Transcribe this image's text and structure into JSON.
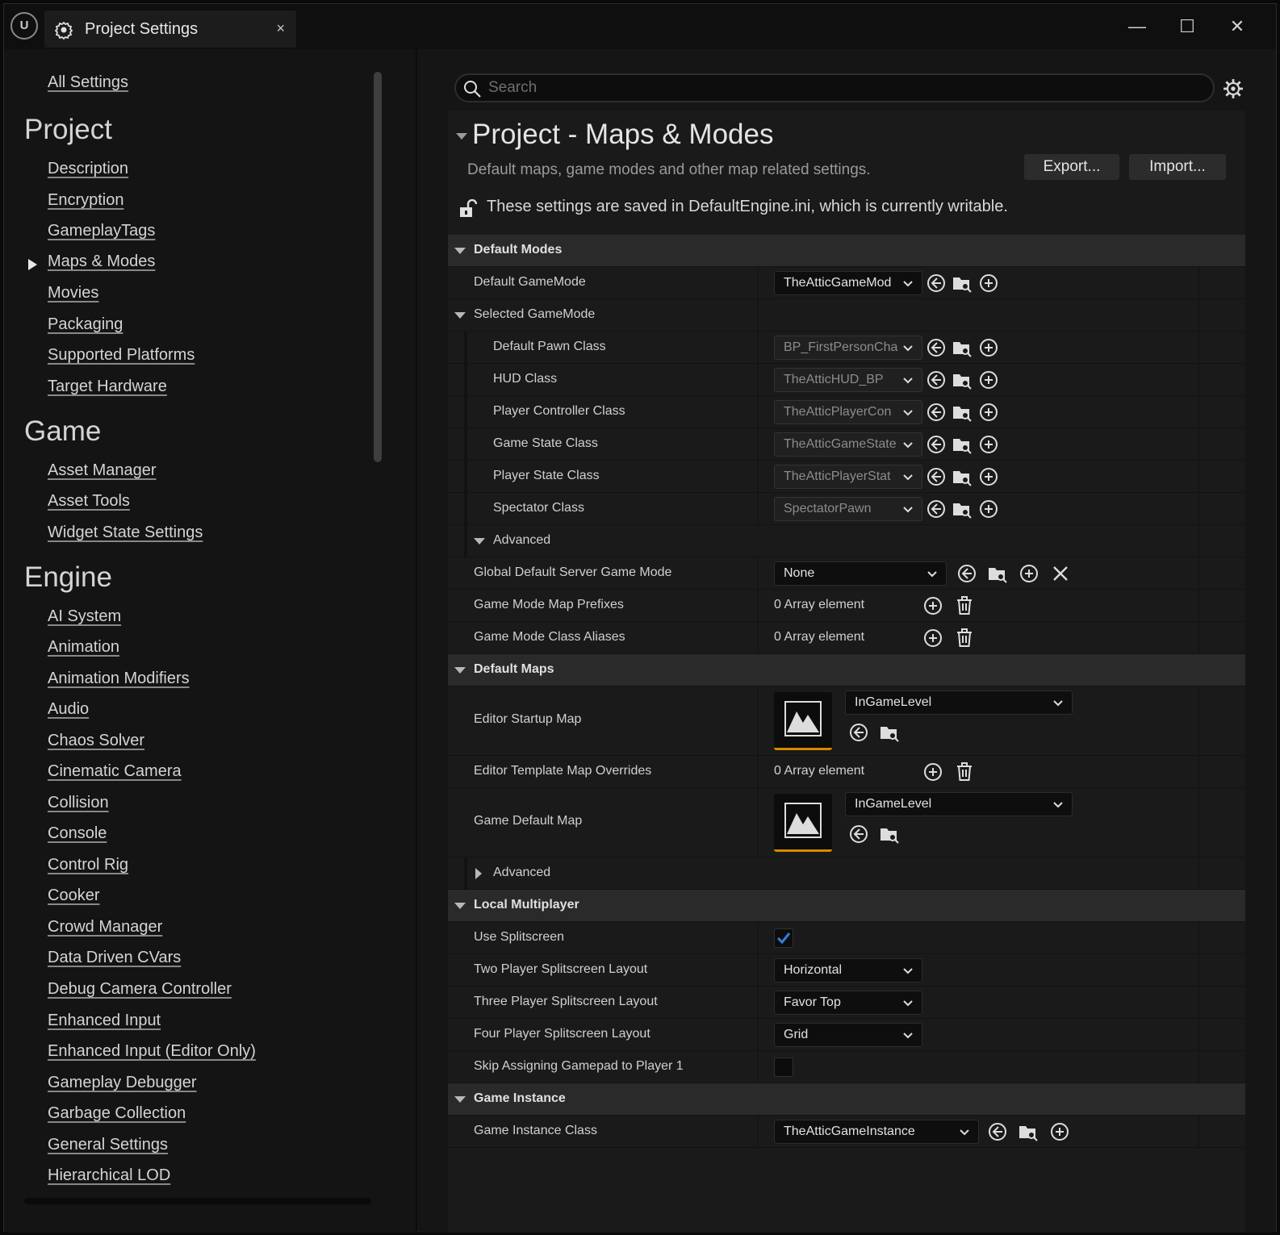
{
  "window": {
    "tab_title": "Project Settings",
    "tab_close": "×",
    "logo": "U",
    "minimize": "—",
    "maximize": "☐",
    "close": "✕"
  },
  "sidebar": {
    "all_settings": "All Settings",
    "sections": [
      {
        "title": "Project",
        "items": [
          "Description",
          "Encryption",
          "GameplayTags",
          "Maps & Modes",
          "Movies",
          "Packaging",
          "Supported Platforms",
          "Target Hardware"
        ]
      },
      {
        "title": "Game",
        "items": [
          "Asset Manager",
          "Asset Tools",
          "Widget State Settings"
        ]
      },
      {
        "title": "Engine",
        "items": [
          "AI System",
          "Animation",
          "Animation Modifiers",
          "Audio",
          "Chaos Solver",
          "Cinematic Camera",
          "Collision",
          "Console",
          "Control Rig",
          "Cooker",
          "Crowd Manager",
          "Data Driven CVars",
          "Debug Camera Controller",
          "Enhanced Input",
          "Enhanced Input (Editor Only)",
          "Gameplay Debugger",
          "Garbage Collection",
          "General Settings",
          "Hierarchical LOD"
        ]
      }
    ],
    "selected": "Maps & Modes"
  },
  "search": {
    "placeholder": "Search"
  },
  "page": {
    "title": "Project - Maps & Modes",
    "description": "Default maps, game modes and other map related settings.",
    "export_label": "Export...",
    "import_label": "Import...",
    "note": "These settings are saved in DefaultEngine.ini, which is currently writable."
  },
  "default_modes": {
    "header": "Default Modes",
    "default_gamemode": {
      "label": "Default GameMode",
      "value": "TheAtticGameMod"
    },
    "selected_gamemode": "Selected GameMode",
    "pawn": {
      "label": "Default Pawn Class",
      "value": "BP_FirstPersonCha"
    },
    "hud": {
      "label": "HUD Class",
      "value": "TheAtticHUD_BP"
    },
    "controller": {
      "label": "Player Controller Class",
      "value": "TheAtticPlayerCon"
    },
    "game_state": {
      "label": "Game State Class",
      "value": "TheAtticGameState"
    },
    "player_state": {
      "label": "Player State Class",
      "value": "TheAtticPlayerStat"
    },
    "spectator": {
      "label": "Spectator Class",
      "value": "SpectatorPawn"
    },
    "advanced": "Advanced",
    "server_mode": {
      "label": "Global Default Server Game Mode",
      "value": "None"
    },
    "prefixes": {
      "label": "Game Mode Map Prefixes",
      "value": "0 Array element"
    },
    "aliases": {
      "label": "Game Mode Class Aliases",
      "value": "0 Array element"
    }
  },
  "default_maps": {
    "header": "Default Maps",
    "startup": {
      "label": "Editor Startup Map",
      "value": "InGameLevel"
    },
    "template": {
      "label": "Editor Template Map Overrides",
      "value": "0 Array element"
    },
    "game_default": {
      "label": "Game Default Map",
      "value": "InGameLevel"
    },
    "advanced": "Advanced"
  },
  "local_multiplayer": {
    "header": "Local Multiplayer",
    "use_splitscreen": {
      "label": "Use Splitscreen",
      "checked": true
    },
    "two_player": {
      "label": "Two Player Splitscreen Layout",
      "value": "Horizontal"
    },
    "three_player": {
      "label": "Three Player Splitscreen Layout",
      "value": "Favor Top"
    },
    "four_player": {
      "label": "Four Player Splitscreen Layout",
      "value": "Grid"
    },
    "skip_gamepad": {
      "label": "Skip Assigning Gamepad to Player 1",
      "checked": false
    }
  },
  "game_instance": {
    "header": "Game Instance",
    "class": {
      "label": "Game Instance Class",
      "value": "TheAtticGameInstance"
    }
  },
  "colors": {
    "accent": "#2f7fdc",
    "thumb_underline": "#d48a00",
    "category_bg": "#2a2a2a"
  },
  "icons": [
    "unreal-logo-icon",
    "settings-gear-icon",
    "search-icon",
    "lock-open-icon",
    "reset-arrow-icon",
    "browse-folder-icon",
    "add-circle-icon",
    "clear-x-icon",
    "trash-icon",
    "chevron-down-icon",
    "level-thumbnail-icon",
    "checkmark-icon"
  ]
}
